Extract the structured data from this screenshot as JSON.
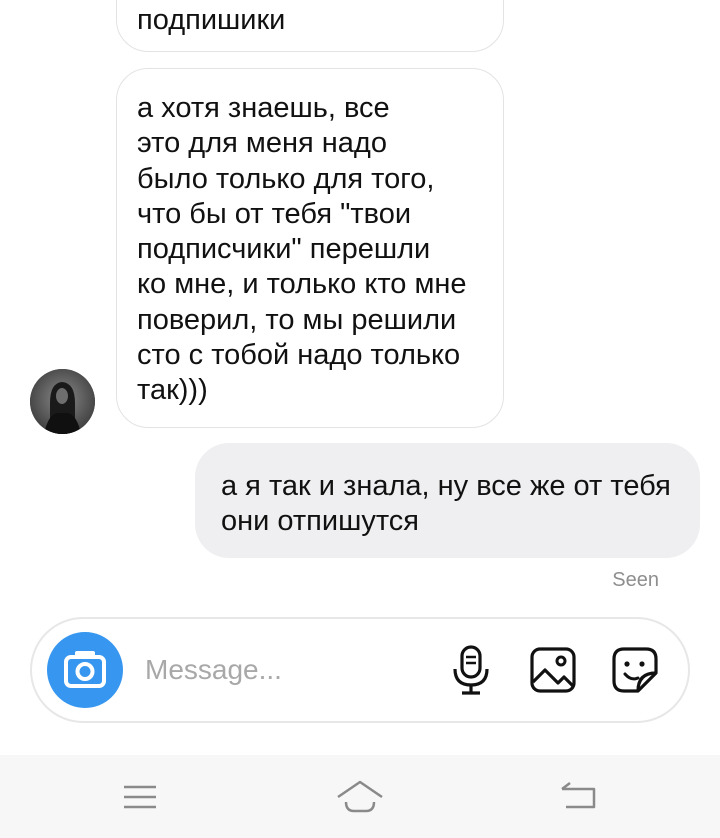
{
  "messages": [
    {
      "id": "msg1",
      "direction": "incoming",
      "text": "подпишики"
    },
    {
      "id": "msg2",
      "direction": "incoming",
      "text": "а хотя знаешь, все\nэто для меня надо\nбыло только для того,\nчто бы от тебя \"твои\nподписчики\" перешли\nко мне, и только кто мне\nповерил, то мы решили\nсто с тобой надо только\nтак)))"
    },
    {
      "id": "msg3",
      "direction": "outgoing",
      "text": "а я так и знала, ну все же от тебя\nони отпишутся"
    }
  ],
  "status": {
    "seen": "Seen"
  },
  "composer": {
    "placeholder": "Message..."
  },
  "colors": {
    "accent": "#3797f0",
    "outgoing_bubble": "#efeff1",
    "incoming_border": "#e3e3e3",
    "secondary_text": "#8e8e8e"
  },
  "icons": {
    "camera": "camera-icon",
    "microphone": "microphone-icon",
    "gallery": "image-icon",
    "sticker": "sticker-icon",
    "nav_menu": "menu-icon",
    "nav_home": "home-icon",
    "nav_back": "back-icon"
  }
}
